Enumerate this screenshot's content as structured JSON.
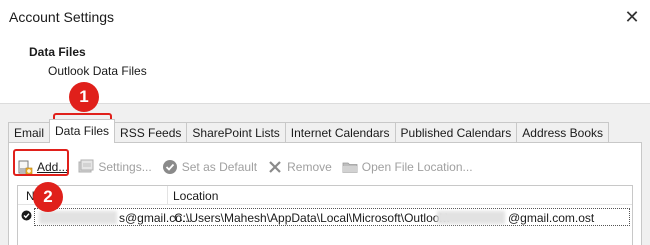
{
  "window": {
    "title": "Account Settings",
    "close_glyph": "✕"
  },
  "header": {
    "title": "Data Files",
    "subtitle": "Outlook Data Files"
  },
  "tabs": [
    {
      "label": "Email"
    },
    {
      "label": "Data Files"
    },
    {
      "label": "RSS Feeds"
    },
    {
      "label": "SharePoint Lists"
    },
    {
      "label": "Internet Calendars"
    },
    {
      "label": "Published Calendars"
    },
    {
      "label": "Address Books"
    }
  ],
  "toolbar": {
    "add": "Add...",
    "settings": "Settings...",
    "set_default": "Set as Default",
    "remove": "Remove",
    "open_location": "Open File Location..."
  },
  "table": {
    "columns": {
      "name": "N",
      "location": "Location"
    },
    "rows": [
      {
        "name": "s@gmail.co...",
        "location_start": "C:\\Users\\Mahesh\\AppData\\Local\\Microsoft\\Outlook\\",
        "location_end": "@gmail.com.ost"
      }
    ]
  },
  "callouts": {
    "one": "1",
    "two": "2"
  },
  "colors": {
    "highlight": "#e0201b",
    "dialog_bg": "#f0f0f0"
  }
}
